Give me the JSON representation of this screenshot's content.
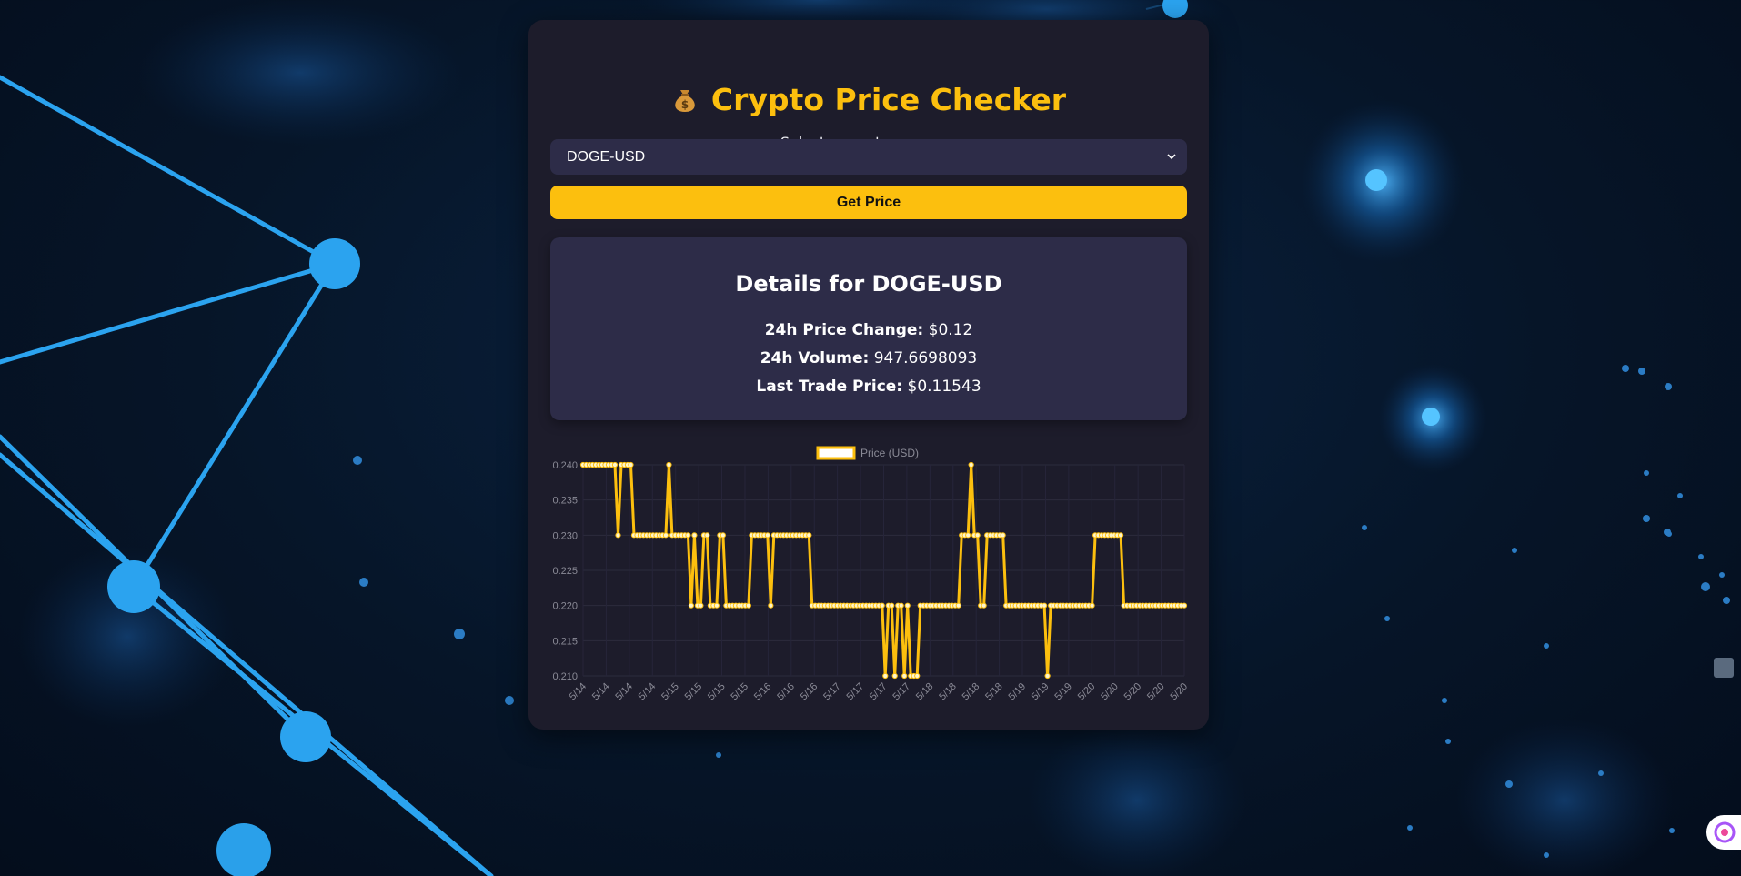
{
  "app": {
    "title": "Crypto Price Checker",
    "title_icon": "money-bag-icon",
    "accent_color": "#fcbf0e",
    "card_color": "#1d1c2b",
    "panel_color": "#2d2c48"
  },
  "selector": {
    "label": "Select a cryptocurrency:",
    "selected": "DOGE-USD"
  },
  "actions": {
    "get_price": "Get Price"
  },
  "details": {
    "title": "Details for DOGE-USD",
    "rows": [
      {
        "key": "24h Price Change:",
        "value": "$0.12"
      },
      {
        "key": "24h Volume:",
        "value": "947.6698093"
      },
      {
        "key": "Last Trade Price:",
        "value": "$0.11543"
      }
    ]
  },
  "chart_data": {
    "type": "line",
    "series": [
      {
        "name": "Price (USD)",
        "color": "#fcbf0e",
        "values": [
          0.24,
          0.24,
          0.24,
          0.24,
          0.24,
          0.24,
          0.24,
          0.24,
          0.24,
          0.24,
          0.24,
          0.23,
          0.24,
          0.24,
          0.24,
          0.24,
          0.23,
          0.23,
          0.23,
          0.23,
          0.23,
          0.23,
          0.23,
          0.23,
          0.23,
          0.23,
          0.23,
          0.24,
          0.23,
          0.23,
          0.23,
          0.23,
          0.23,
          0.23,
          0.22,
          0.23,
          0.22,
          0.22,
          0.23,
          0.23,
          0.22,
          0.22,
          0.22,
          0.23,
          0.23,
          0.22,
          0.22,
          0.22,
          0.22,
          0.22,
          0.22,
          0.22,
          0.22,
          0.23,
          0.23,
          0.23,
          0.23,
          0.23,
          0.23,
          0.22,
          0.23,
          0.23,
          0.23,
          0.23,
          0.23,
          0.23,
          0.23,
          0.23,
          0.23,
          0.23,
          0.23,
          0.23,
          0.22,
          0.22,
          0.22,
          0.22,
          0.22,
          0.22,
          0.22,
          0.22,
          0.22,
          0.22,
          0.22,
          0.22,
          0.22,
          0.22,
          0.22,
          0.22,
          0.22,
          0.22,
          0.22,
          0.22,
          0.22,
          0.22,
          0.22,
          0.21,
          0.22,
          0.22,
          0.21,
          0.22,
          0.22,
          0.21,
          0.22,
          0.21,
          0.21,
          0.21,
          0.22,
          0.22,
          0.22,
          0.22,
          0.22,
          0.22,
          0.22,
          0.22,
          0.22,
          0.22,
          0.22,
          0.22,
          0.22,
          0.23,
          0.23,
          0.23,
          0.24,
          0.23,
          0.23,
          0.22,
          0.22,
          0.23,
          0.23,
          0.23,
          0.23,
          0.23,
          0.23,
          0.22,
          0.22,
          0.22,
          0.22,
          0.22,
          0.22,
          0.22,
          0.22,
          0.22,
          0.22,
          0.22,
          0.22,
          0.22,
          0.21,
          0.22,
          0.22,
          0.22,
          0.22,
          0.22,
          0.22,
          0.22,
          0.22,
          0.22,
          0.22,
          0.22,
          0.22,
          0.22,
          0.22,
          0.23,
          0.23,
          0.23,
          0.23,
          0.23,
          0.23,
          0.23,
          0.23,
          0.23,
          0.22,
          0.22,
          0.22,
          0.22,
          0.22,
          0.22,
          0.22,
          0.22,
          0.22,
          0.22,
          0.22,
          0.22,
          0.22,
          0.22,
          0.22,
          0.22,
          0.22,
          0.22,
          0.22,
          0.22
        ]
      }
    ],
    "x_tick_labels": [
      "5/14",
      "5/14",
      "5/14",
      "5/14",
      "5/15",
      "5/15",
      "5/15",
      "5/15",
      "5/16",
      "5/16",
      "5/16",
      "5/17",
      "5/17",
      "5/17",
      "5/17",
      "5/18",
      "5/18",
      "5/18",
      "5/18",
      "5/19",
      "5/19",
      "5/19",
      "5/20",
      "5/20",
      "5/20",
      "5/20",
      "5/20"
    ],
    "y_ticks": [
      "0.240",
      "0.235",
      "0.230",
      "0.225",
      "0.220",
      "0.215",
      "0.210"
    ],
    "ylim": [
      0.21,
      0.24
    ],
    "legend": "top-center",
    "grid": true
  }
}
